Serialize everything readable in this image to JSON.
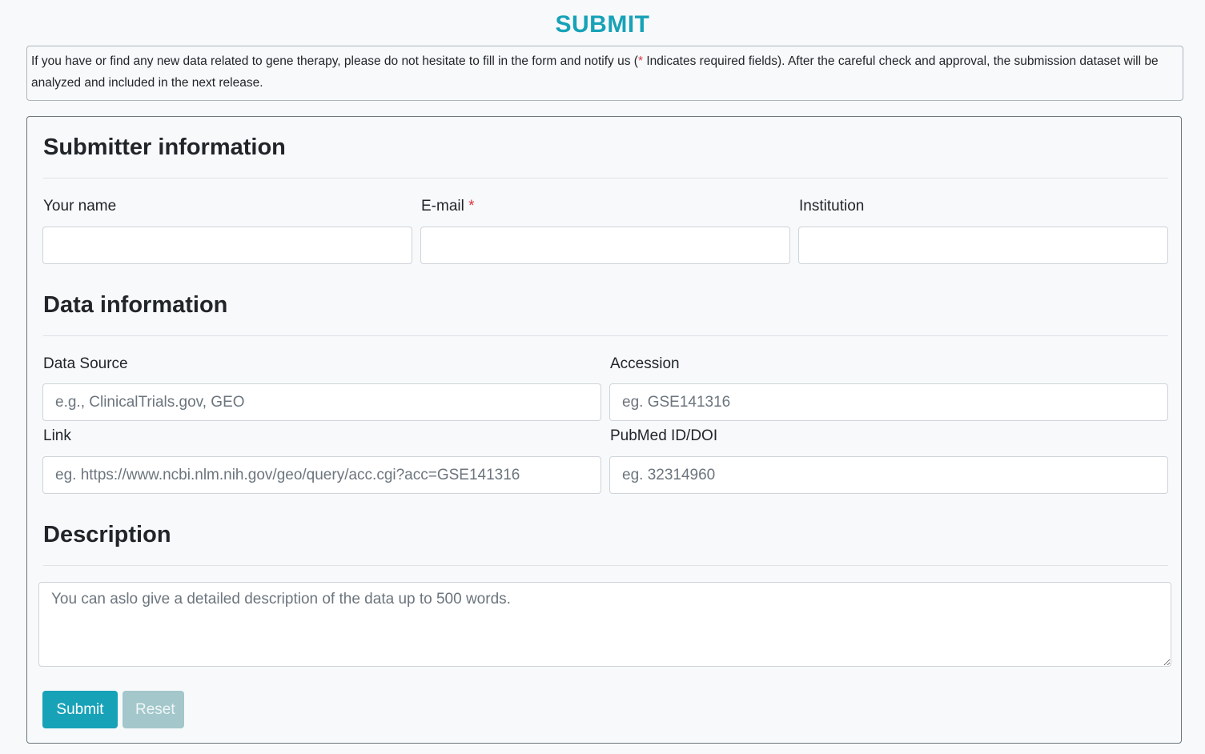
{
  "page": {
    "title": "SUBMIT",
    "notice_before": "If you have or find any new data related to gene therapy, please do not hesitate to fill in the form and notify us (",
    "notice_star": "*",
    "notice_after": " Indicates required fields). After the careful check and approval, the submission dataset will be analyzed and included in the next release."
  },
  "submitter": {
    "heading": "Submitter information",
    "name_label": "Your name",
    "email_label": "E-mail",
    "email_required": "*",
    "institution_label": "Institution"
  },
  "data_info": {
    "heading": "Data information",
    "source_label": "Data Source",
    "source_placeholder": "e.g., ClinicalTrials.gov, GEO",
    "accession_label": "Accession",
    "accession_placeholder": "eg. GSE141316",
    "link_label": "Link",
    "link_placeholder": "eg. https://www.ncbi.nlm.nih.gov/geo/query/acc.cgi?acc=GSE141316",
    "pubmed_label": "PubMed ID/DOI",
    "pubmed_placeholder": "eg. 32314960"
  },
  "description": {
    "heading": "Description",
    "placeholder": "You can aslo give a detailed description of the data up to 500 words."
  },
  "buttons": {
    "submit_label": "Submit",
    "reset_label": "Reset"
  },
  "colors": {
    "accent": "#17a2b8",
    "required": "#dc3545",
    "reset_disabled": "#a3c7cb"
  }
}
